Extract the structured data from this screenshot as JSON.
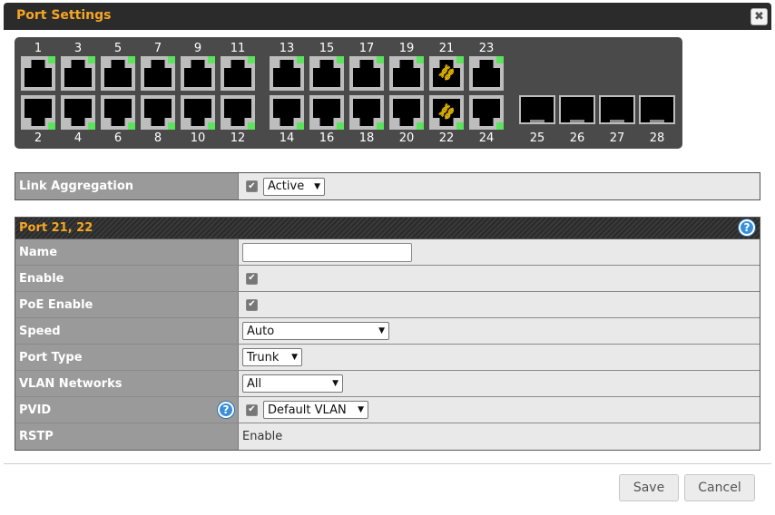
{
  "window": {
    "title": "Port Settings",
    "close_glyph": "✖"
  },
  "ports": {
    "top_numbers": [
      "1",
      "3",
      "5",
      "7",
      "9",
      "11",
      "13",
      "15",
      "17",
      "19",
      "21",
      "23"
    ],
    "bottom_numbers": [
      "2",
      "4",
      "6",
      "8",
      "10",
      "12",
      "14",
      "16",
      "18",
      "20",
      "22",
      "24"
    ],
    "sfp_numbers": [
      "25",
      "26",
      "27",
      "28"
    ],
    "selected": [
      "21",
      "22"
    ],
    "link_icon": "chain-link-icon",
    "led_color": "#5be35b"
  },
  "link_aggregation": {
    "label": "Link Aggregation",
    "checked": true,
    "mode": "Active"
  },
  "section": {
    "title": "Port 21, 22",
    "help_glyph": "?"
  },
  "fields": {
    "name": {
      "label": "Name",
      "value": ""
    },
    "enable": {
      "label": "Enable",
      "checked": true
    },
    "poe": {
      "label": "PoE Enable",
      "checked": true
    },
    "speed": {
      "label": "Speed",
      "value": "Auto"
    },
    "port_type": {
      "label": "Port Type",
      "value": "Trunk"
    },
    "vlan_networks": {
      "label": "VLAN Networks",
      "value": "All"
    },
    "pvid": {
      "label": "PVID",
      "checked": true,
      "value": "Default VLAN"
    },
    "rstp": {
      "label": "RSTP",
      "value": "Enable"
    }
  },
  "buttons": {
    "save": "Save",
    "cancel": "Cancel"
  },
  "colors": {
    "accent": "#f5a623",
    "label_bg": "#9a9a9a",
    "value_bg": "#e9e9e9"
  }
}
